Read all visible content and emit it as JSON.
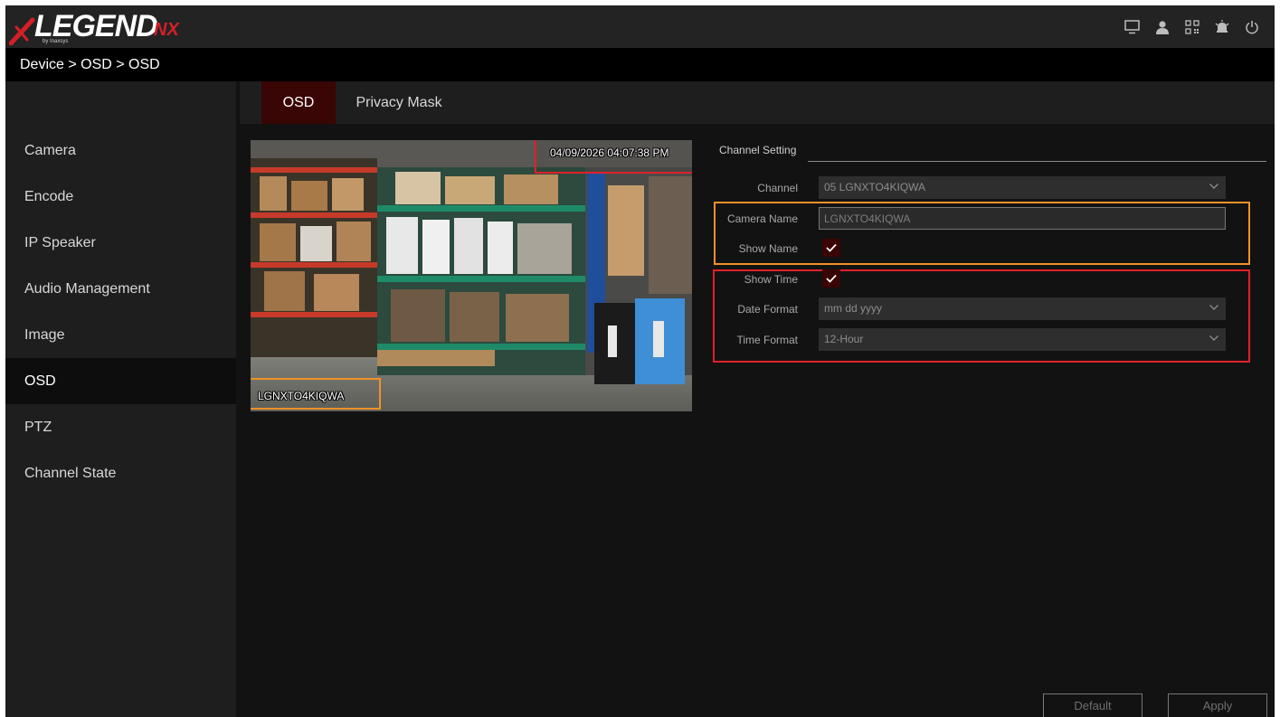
{
  "app": {
    "brand": "LEGEND",
    "brand_suffix": "NX",
    "brand_tagline": "by Inaxsys",
    "top_icons": [
      "monitor-icon",
      "user-icon",
      "qr-code-icon",
      "alarm-bell-icon",
      "power-icon"
    ]
  },
  "breadcrumb": "Device > OSD > OSD",
  "sidebar": {
    "items": [
      {
        "label": "Camera",
        "active": false
      },
      {
        "label": "Encode",
        "active": false
      },
      {
        "label": "IP Speaker",
        "active": false
      },
      {
        "label": "Audio Management",
        "active": false
      },
      {
        "label": "Image",
        "active": false
      },
      {
        "label": "OSD",
        "active": true
      },
      {
        "label": "PTZ",
        "active": false
      },
      {
        "label": "Channel State",
        "active": false
      }
    ]
  },
  "tabs": [
    {
      "label": "OSD",
      "active": true
    },
    {
      "label": "Privacy Mask",
      "active": false
    }
  ],
  "preview": {
    "timestamp_overlay": "04/09/2026 04:07:38 PM",
    "name_overlay": "LGNXTO4KIQWA"
  },
  "channel_setting": {
    "title": "Channel Setting",
    "channel_label": "Channel",
    "channel_value": "05 LGNXTO4KIQWA",
    "camera_name_label": "Camera Name",
    "camera_name_value": "LGNXTO4KIQWA",
    "show_name_label": "Show Name",
    "show_name_checked": true,
    "show_time_label": "Show Time",
    "show_time_checked": true,
    "date_format_label": "Date Format",
    "date_format_value": "mm dd yyyy",
    "time_format_label": "Time Format",
    "time_format_value": "12-Hour"
  },
  "buttons": {
    "default_label": "Default",
    "apply_label": "Apply"
  },
  "colors": {
    "accent_dark_red": "#3a0505",
    "brand_red": "#d32028",
    "highlight_orange": "#f0922a",
    "highlight_red": "#e0202a"
  }
}
